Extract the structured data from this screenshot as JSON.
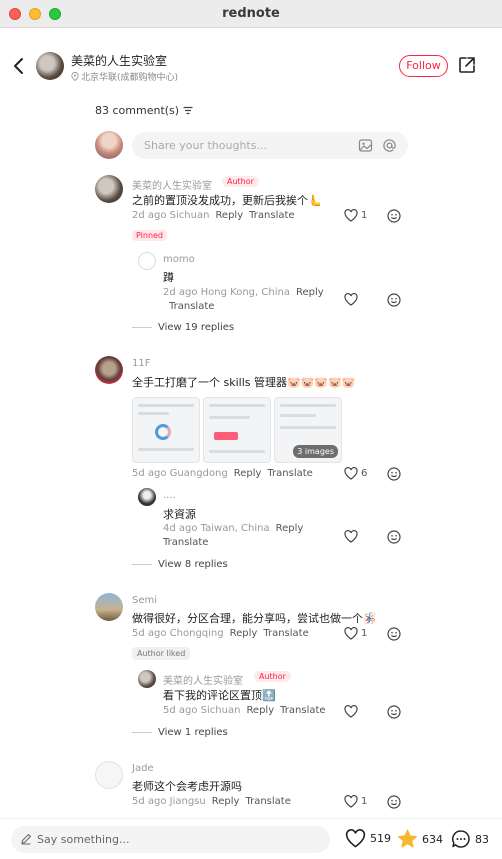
{
  "window": {
    "title": "rednote"
  },
  "header": {
    "author_name": "美菜的人生实验室",
    "author_location": "北京华联(成都购物中心)",
    "follow_label": "Follow"
  },
  "comments_count": "83 comment(s)",
  "compose": {
    "placeholder": "Share your thoughts..."
  },
  "comments": [
    {
      "user": "美菜的人生实验室",
      "badge": "Author",
      "text": "之前的置顶没发成功，更新后我挨个🫷",
      "time_loc": "2d ago Sichuan",
      "reply": "Reply",
      "translate": "Translate",
      "likes": "1",
      "tag": "Pinned",
      "replies": [
        {
          "user": "momo",
          "text": "蹲",
          "time_loc": "2d ago Hong Kong, China",
          "reply": "Reply",
          "translate": "Translate"
        }
      ],
      "view_replies": "View 19 replies"
    },
    {
      "user": "11F",
      "text": "全手工打磨了一个 skills 管理器🐷🐷🐷🐷🐷",
      "images_more": "3 images",
      "time_loc": "5d ago Guangdong",
      "reply": "Reply",
      "translate": "Translate",
      "likes": "6",
      "replies": [
        {
          "user": "....",
          "text": "求資源",
          "time_loc": "4d ago Taiwan, China",
          "reply": "Reply",
          "translate": "Translate"
        }
      ],
      "view_replies": "View 8 replies"
    },
    {
      "user": "Semi",
      "text": "做得很好，分区合理，能分享吗，尝试也做一个🪅",
      "time_loc": "5d ago Chongqing",
      "reply": "Reply",
      "translate": "Translate",
      "likes": "1",
      "tag": "Author liked",
      "replies": [
        {
          "user": "美菜的人生实验室",
          "badge": "Author",
          "text": "看下我的评论区置顶🔝",
          "time_loc": "5d ago Sichuan",
          "reply": "Reply",
          "translate": "Translate"
        }
      ],
      "view_replies": "View 1 replies"
    },
    {
      "user": "Jade",
      "text": "老师这个会考虑开源吗",
      "time_loc": "5d ago Jiangsu",
      "reply": "Reply",
      "translate": "Translate",
      "likes": "1"
    }
  ],
  "bottom": {
    "say_placeholder": "Say something...",
    "likes": "519",
    "stars": "634",
    "comments": "83"
  },
  "colors": {
    "brand": "#ff2442",
    "star": "#f5b82e"
  },
  "icons": [
    "back-icon",
    "share-icon",
    "location-icon",
    "sort-icon",
    "image-icon",
    "at-icon",
    "heart-icon",
    "emoji-icon",
    "pencil-icon",
    "star-icon",
    "comment-icon"
  ]
}
